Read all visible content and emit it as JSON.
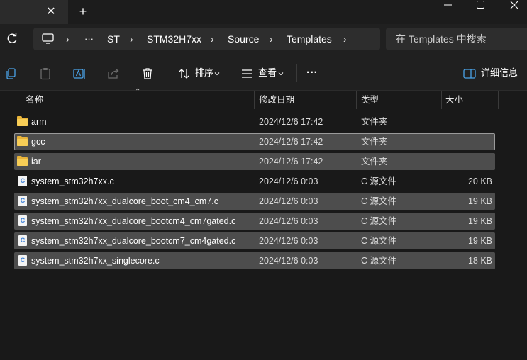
{
  "window": {
    "tab_close": "✕",
    "new_tab": "+",
    "minimize": "—",
    "maximize": "☐",
    "close": "✕"
  },
  "address": {
    "more": "···",
    "crumbs": [
      "ST",
      "STM32H7xx",
      "Source",
      "Templates"
    ],
    "search_placeholder": "在 Templates 中搜索"
  },
  "toolbar": {
    "sort_label": "排序",
    "view_label": "查看",
    "more": "···",
    "details_label": "详细信息"
  },
  "columns": {
    "name": "名称",
    "modified": "修改日期",
    "type": "类型",
    "size": "大小"
  },
  "files": [
    {
      "name": "arm",
      "modified": "2024/12/6 17:42",
      "type": "文件夹",
      "size": "",
      "icon": "folder-icon"
    },
    {
      "name": "gcc",
      "modified": "2024/12/6 17:42",
      "type": "文件夹",
      "size": "",
      "icon": "folder-icon"
    },
    {
      "name": "iar",
      "modified": "2024/12/6 17:42",
      "type": "文件夹",
      "size": "",
      "icon": "folder-icon"
    },
    {
      "name": "system_stm32h7xx.c",
      "modified": "2024/12/6 0:03",
      "type": "C 源文件",
      "size": "20 KB",
      "icon": "c-file-icon"
    },
    {
      "name": "system_stm32h7xx_dualcore_boot_cm4_cm7.c",
      "modified": "2024/12/6 0:03",
      "type": "C 源文件",
      "size": "19 KB",
      "icon": "c-file-icon"
    },
    {
      "name": "system_stm32h7xx_dualcore_bootcm4_cm7gated.c",
      "modified": "2024/12/6 0:03",
      "type": "C 源文件",
      "size": "19 KB",
      "icon": "c-file-icon"
    },
    {
      "name": "system_stm32h7xx_dualcore_bootcm7_cm4gated.c",
      "modified": "2024/12/6 0:03",
      "type": "C 源文件",
      "size": "19 KB",
      "icon": "c-file-icon"
    },
    {
      "name": "system_stm32h7xx_singlecore.c",
      "modified": "2024/12/6 0:03",
      "type": "C 源文件",
      "size": "18 KB",
      "icon": "c-file-icon"
    }
  ],
  "colors": {
    "background": "#191919",
    "selection": "#4d4d4d",
    "folder": "#f7cd56"
  }
}
